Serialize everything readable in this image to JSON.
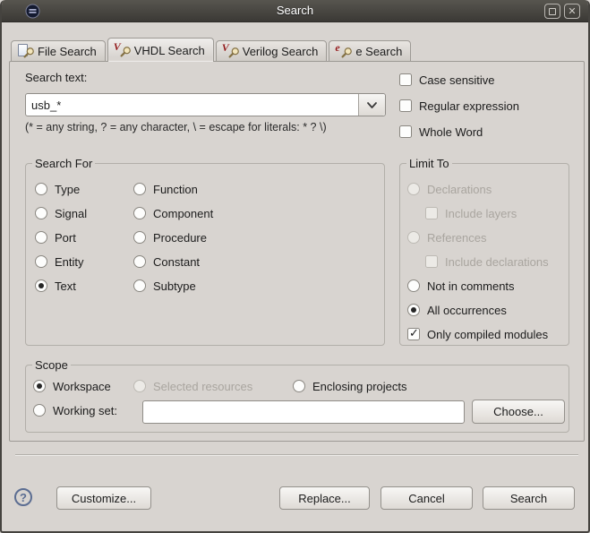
{
  "window": {
    "title": "Search",
    "icons": {
      "app": "eclipse-sphere",
      "maximize": "maximize",
      "close": "✕"
    }
  },
  "tabs": [
    {
      "label": "File Search",
      "badge": "",
      "active": false
    },
    {
      "label": "VHDL Search",
      "badge": "V",
      "active": true
    },
    {
      "label": "Verilog Search",
      "badge": "V",
      "active": false
    },
    {
      "label": "e Search",
      "badge": "e",
      "active": false
    }
  ],
  "search": {
    "label": "Search text:",
    "value": "usb_*",
    "hint": "(* = any string, ? = any character, \\ = escape for literals: * ? \\)"
  },
  "options": [
    {
      "label": "Case sensitive",
      "type": "checkbox",
      "checked": false
    },
    {
      "label": "Regular expression",
      "type": "checkbox",
      "checked": false
    },
    {
      "label": "Whole Word",
      "type": "checkbox",
      "checked": false
    }
  ],
  "search_for": {
    "title": "Search For",
    "col1": [
      {
        "label": "Type",
        "type": "radio"
      },
      {
        "label": "Signal",
        "type": "radio"
      },
      {
        "label": "Port",
        "type": "radio"
      },
      {
        "label": "Entity",
        "type": "radio"
      },
      {
        "label": "Text",
        "type": "radio",
        "selected": true
      }
    ],
    "col2": [
      {
        "label": "Function",
        "type": "radio"
      },
      {
        "label": "Component",
        "type": "radio"
      },
      {
        "label": "Procedure",
        "type": "radio"
      },
      {
        "label": "Constant",
        "type": "radio"
      },
      {
        "label": "Subtype",
        "type": "radio"
      }
    ]
  },
  "limit_to": {
    "title": "Limit To",
    "items": [
      {
        "label": "Declarations",
        "type": "radio",
        "disabled": true
      },
      {
        "label": "Include layers",
        "type": "checkbox",
        "disabled": true,
        "indent": true
      },
      {
        "label": "References",
        "type": "radio",
        "disabled": true
      },
      {
        "label": "Include declarations",
        "type": "checkbox",
        "disabled": true,
        "indent": true
      },
      {
        "label": "Not in comments",
        "type": "radio"
      },
      {
        "label": "All occurrences",
        "type": "radio",
        "selected": true
      },
      {
        "label": "Only compiled modules",
        "type": "checkbox",
        "checked": true
      }
    ]
  },
  "scope": {
    "title": "Scope",
    "workspace_label": "Workspace",
    "workspace_selected": true,
    "selected_resources_label": "Selected resources",
    "enclosing_projects_label": "Enclosing projects",
    "working_set_label": "Working set:",
    "working_set_value": "",
    "choose_label": "Choose..."
  },
  "footer": {
    "help": "?",
    "customize": "Customize...",
    "replace": "Replace...",
    "cancel": "Cancel",
    "search": "Search"
  },
  "colors": {
    "titlebar": "#3b3935",
    "body_bg": "#d8d4d0",
    "tab_letter_red": "#8e1515",
    "disabled_text": "#a9a59f",
    "help_accent": "#5b6d92"
  }
}
